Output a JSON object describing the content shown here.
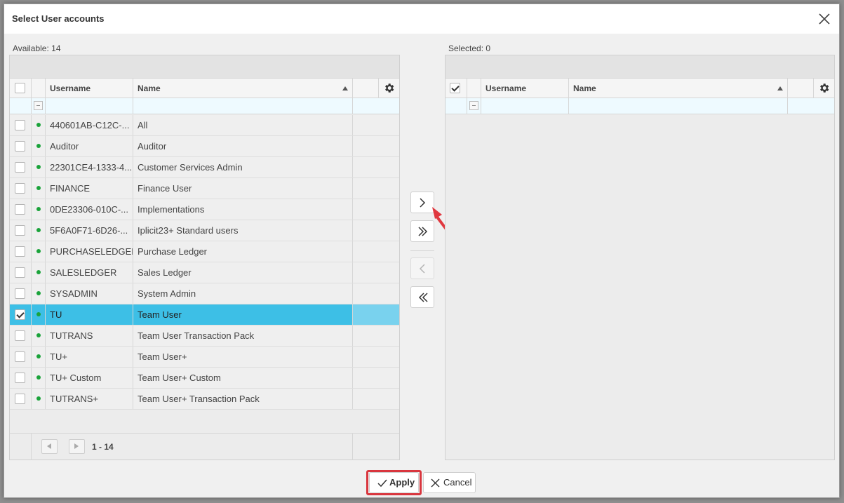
{
  "dialog": {
    "title": "Select User accounts"
  },
  "available": {
    "label": "Available: 14",
    "columns": {
      "username": "Username",
      "name": "Name"
    },
    "rows": [
      {
        "username": "440601AB-C12C-...",
        "name": "All",
        "checked": false
      },
      {
        "username": "Auditor",
        "name": "Auditor",
        "checked": false
      },
      {
        "username": "22301CE4-1333-4...",
        "name": "Customer Services Admin",
        "checked": false
      },
      {
        "username": "FINANCE",
        "name": "Finance User",
        "checked": false
      },
      {
        "username": "0DE23306-010C-...",
        "name": "Implementations",
        "checked": false
      },
      {
        "username": "5F6A0F71-6D26-...",
        "name": "Iplicit23+ Standard users",
        "checked": false
      },
      {
        "username": "PURCHASELEDGER",
        "name": "Purchase Ledger",
        "checked": false
      },
      {
        "username": "SALESLEDGER",
        "name": "Sales Ledger",
        "checked": false
      },
      {
        "username": "SYSADMIN",
        "name": "System Admin",
        "checked": false
      },
      {
        "username": "TU",
        "name": "Team User",
        "checked": true
      },
      {
        "username": "TUTRANS",
        "name": "Team User Transaction Pack",
        "checked": false
      },
      {
        "username": "TU+",
        "name": "Team User+",
        "checked": false
      },
      {
        "username": "TU+ Custom",
        "name": "Team User+ Custom",
        "checked": false
      },
      {
        "username": "TUTRANS+",
        "name": "Team User+ Transaction Pack",
        "checked": false
      }
    ],
    "pager_text": "1 - 14"
  },
  "selected": {
    "label": "Selected: 0",
    "columns": {
      "username": "Username",
      "name": "Name"
    }
  },
  "buttons": {
    "apply": "Apply",
    "cancel": "Cancel"
  },
  "colors": {
    "selected_row": "#3dbfe6",
    "status_dot": "#1aa33a",
    "highlight": "#d9363e"
  }
}
